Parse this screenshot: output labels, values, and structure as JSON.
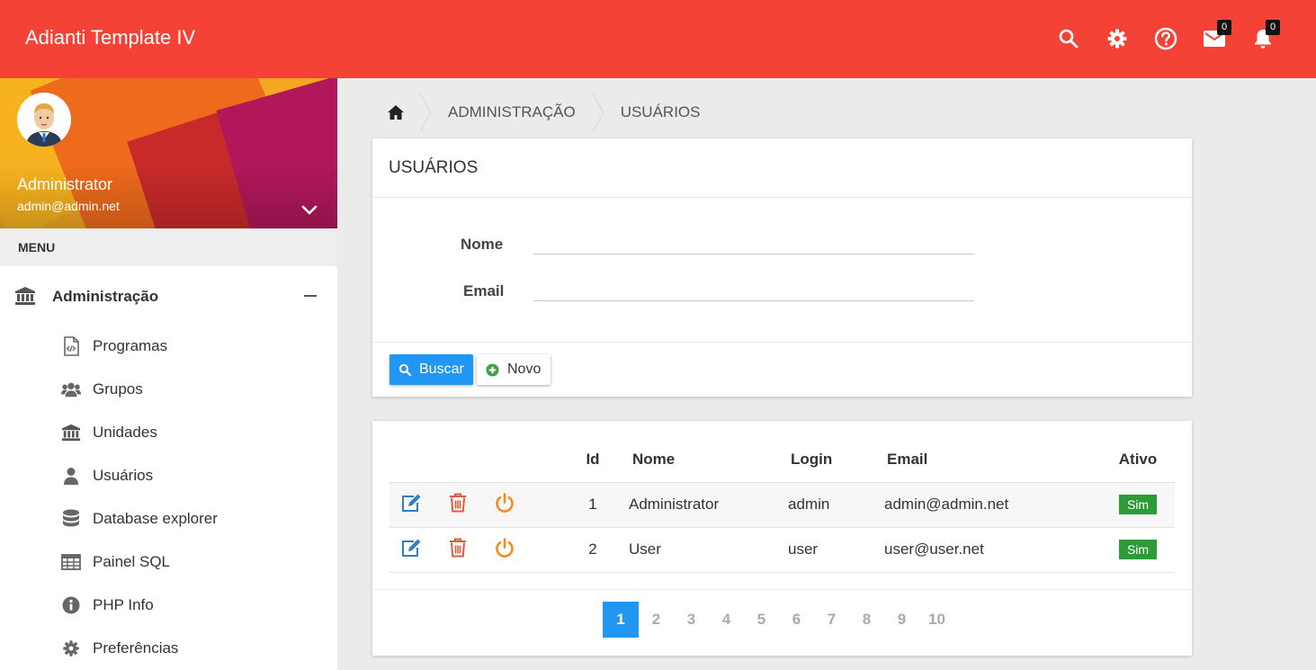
{
  "app": {
    "title": "Adianti Template IV"
  },
  "topbar": {
    "icons": [
      "search-icon",
      "gear-icon",
      "help-icon",
      "mail-icon",
      "bell-icon"
    ],
    "mail_count": "0",
    "notification_count": "0"
  },
  "profile": {
    "name": "Administrator",
    "email": "admin@admin.net"
  },
  "sidebar": {
    "menu_header": "MENU",
    "group": {
      "label": "Administração",
      "icon": "bank-icon",
      "expanded": true
    },
    "items": [
      {
        "label": "Programas",
        "icon": "code-file-icon"
      },
      {
        "label": "Grupos",
        "icon": "users-icon"
      },
      {
        "label": "Unidades",
        "icon": "bank-icon"
      },
      {
        "label": "Usuários",
        "icon": "user-icon"
      },
      {
        "label": "Database explorer",
        "icon": "database-icon"
      },
      {
        "label": "Painel SQL",
        "icon": "table-icon"
      },
      {
        "label": "PHP Info",
        "icon": "info-icon"
      },
      {
        "label": "Preferências",
        "icon": "gear-icon"
      }
    ]
  },
  "breadcrumb": {
    "items": [
      "ADMINISTRAÇÃO",
      "USUÁRIOS"
    ]
  },
  "form": {
    "title": "USUÁRIOS",
    "fields": [
      {
        "label": "Nome",
        "value": ""
      },
      {
        "label": "Email",
        "value": ""
      }
    ],
    "search_button": "Buscar",
    "new_button": "Novo"
  },
  "table": {
    "headers": [
      "Id",
      "Nome",
      "Login",
      "Email",
      "Ativo"
    ],
    "rows": [
      {
        "id": "1",
        "nome": "Administrator",
        "login": "admin",
        "email": "admin@admin.net",
        "ativo": "Sim"
      },
      {
        "id": "2",
        "nome": "User",
        "login": "user",
        "email": "user@user.net",
        "ativo": "Sim"
      }
    ]
  },
  "pagination": {
    "pages": [
      "1",
      "2",
      "3",
      "4",
      "5",
      "6",
      "7",
      "8",
      "9",
      "10"
    ],
    "current": "1"
  },
  "colors": {
    "topbar": "#f44336",
    "primary": "#2196f3",
    "edit_icon": "#2f7fc4",
    "delete_icon": "#e05a3c",
    "power_icon": "#f5891f",
    "active_badge": "#2e9a3a"
  }
}
